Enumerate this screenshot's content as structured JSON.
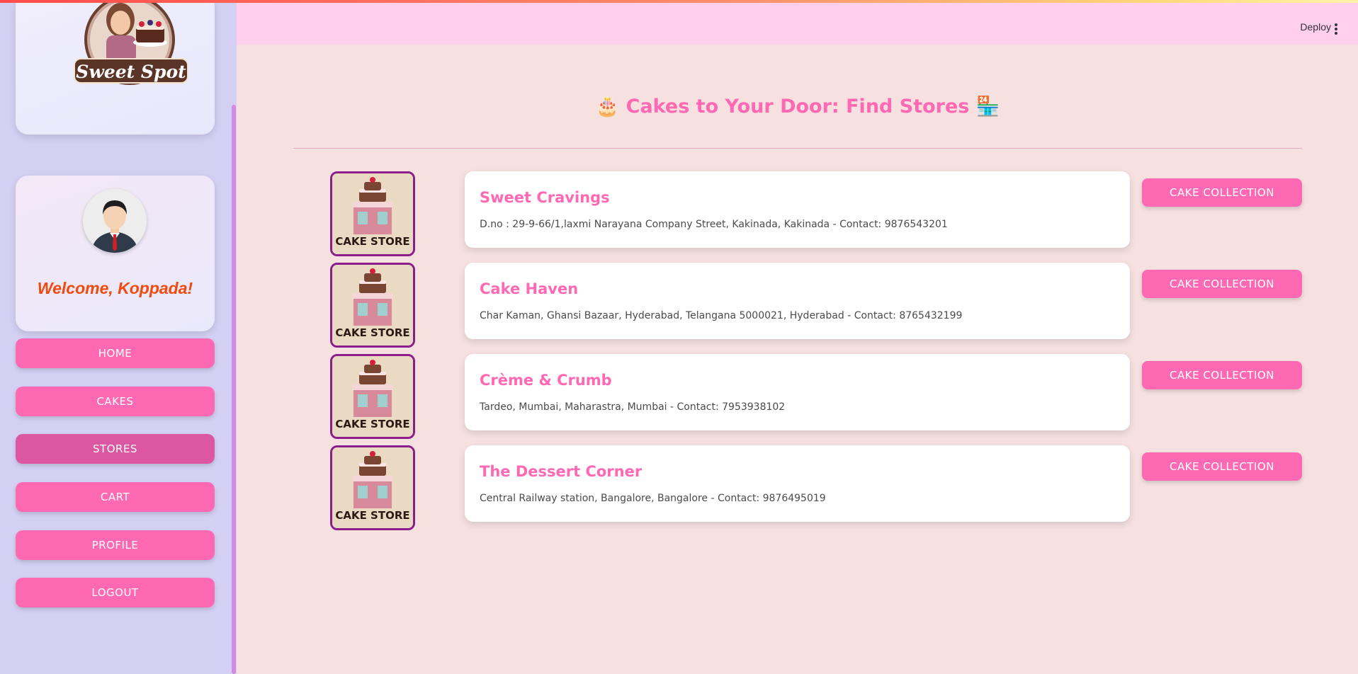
{
  "sidebar": {
    "logo_text": "Sweet Spot",
    "welcome": "Welcome, Koppada!",
    "nav": [
      {
        "label": "HOME"
      },
      {
        "label": "CAKES"
      },
      {
        "label": "STORES"
      },
      {
        "label": "CART"
      },
      {
        "label": "PROFILE"
      },
      {
        "label": "LOGOUT"
      }
    ],
    "active_item": "STORES"
  },
  "header": {
    "deploy_label": "Deploy",
    "menu_icon": "kebab-menu-icon"
  },
  "main": {
    "title": "🎂 Cakes to Your Door: Find Stores 🏪",
    "store_badge_text": "CAKE STORE",
    "stores": [
      {
        "name": "Sweet Cravings",
        "address": "D.no : 29-9-66/1,laxmi Narayana Company Street, Kakinada, Kakinada - Contact: 9876543201",
        "button": "CAKE COLLECTION"
      },
      {
        "name": "Cake Haven",
        "address": "Char Kaman, Ghansi Bazaar, Hyderabad, Telangana 5000021, Hyderabad - Contact: 8765432199",
        "button": "CAKE COLLECTION"
      },
      {
        "name": "Crème & Crumb",
        "address": "Tardeo, Mumbai, Maharastra, Mumbai - Contact: 7953938102",
        "button": "CAKE COLLECTION"
      },
      {
        "name": "The Dessert Corner",
        "address": "Central Railway station, Bangalore, Bangalore - Contact: 9876495019",
        "button": "CAKE COLLECTION"
      }
    ]
  },
  "colors": {
    "accent_pink": "#ff69b4",
    "active_nav": "#db57a2",
    "header_bg": "#ffcfec",
    "welcome_text": "#f24a0d",
    "store_border": "#8b1e8a"
  }
}
